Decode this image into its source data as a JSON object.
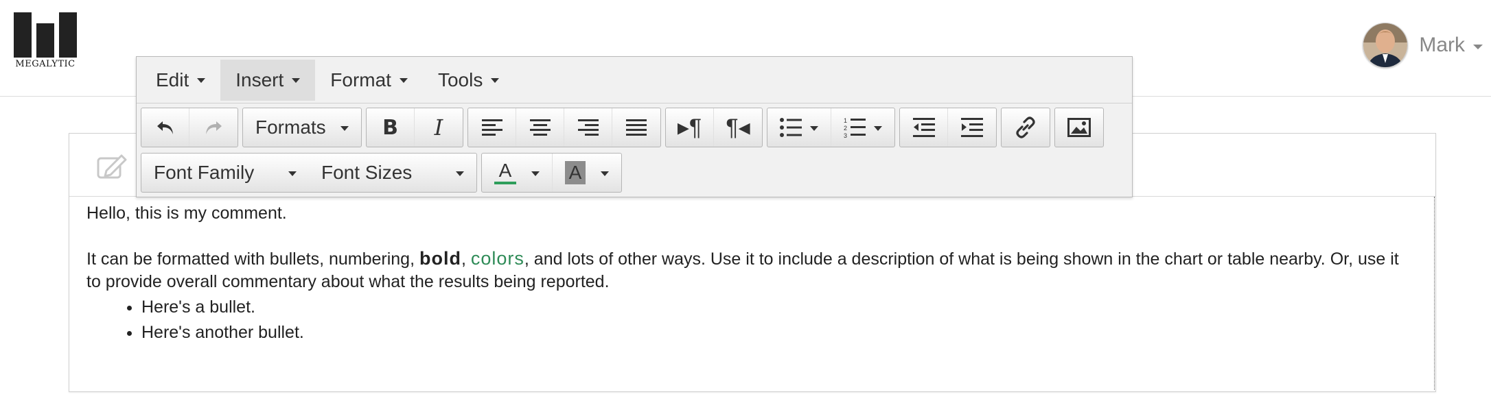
{
  "brand": {
    "logo_text": "MEGALYTIC"
  },
  "user": {
    "name": "Mark"
  },
  "menubar": {
    "edit": "Edit",
    "insert": "Insert",
    "format": "Format",
    "tools": "Tools"
  },
  "toolbar": {
    "formats": "Formats",
    "bold": "B",
    "italic": "I",
    "font_family": "Font Family",
    "font_sizes": "Font Sizes",
    "text_color_letter": "A",
    "bg_color_letter": "A",
    "text_color": "#2e9e5b",
    "bg_color": "#8c8c8c"
  },
  "editor": {
    "line1": "Hello, this is my comment.",
    "para_start": "It can be formatted with bullets, numbering, ",
    "bold_word": "bold",
    "comma": ", ",
    "color_word": "colors",
    "para_end": ", and lots of other ways.  Use it to include a description of what is being shown in the chart or table nearby.  Or, use it to provide overall commentary about what the results being reported.",
    "bullets": [
      "Here's a bullet.",
      "Here's another bullet."
    ]
  },
  "icons": {
    "undo": "undo-icon",
    "redo": "redo-icon",
    "align_left": "align-left-icon",
    "align_center": "align-center-icon",
    "align_right": "align-right-icon",
    "justify": "justify-icon",
    "ltr": "ltr-icon",
    "rtl": "rtl-icon",
    "bullet_list": "bullet-list-icon",
    "numbered_list": "numbered-list-icon",
    "outdent": "outdent-icon",
    "indent": "indent-icon",
    "link": "link-icon",
    "image": "image-icon",
    "edit": "pencil-square-icon"
  }
}
